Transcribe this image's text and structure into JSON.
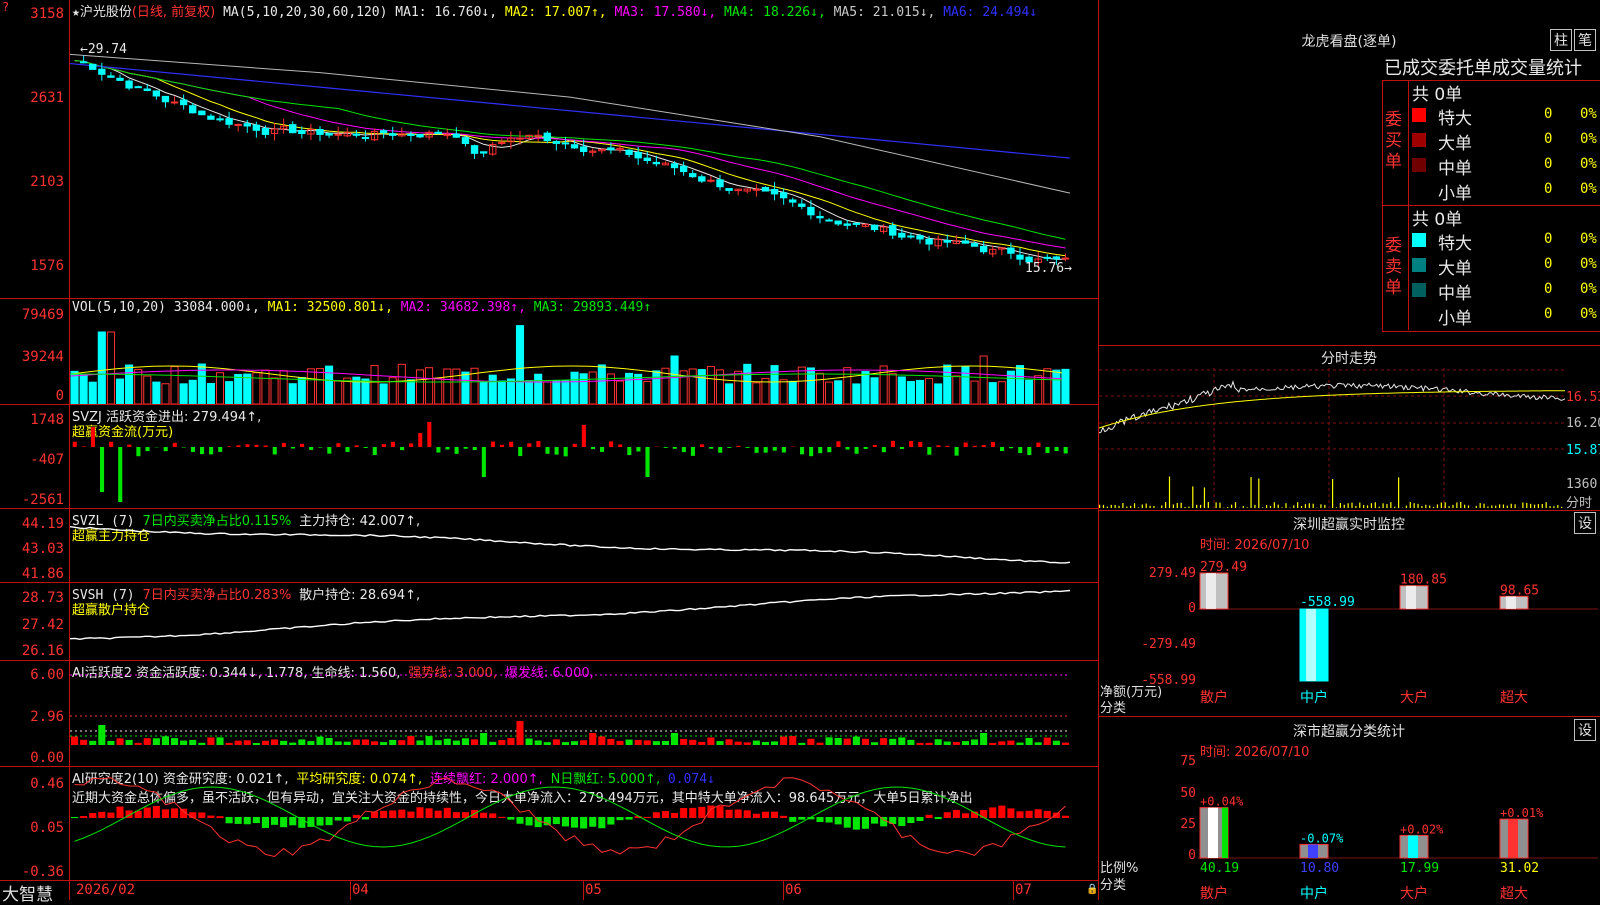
{
  "stock": {
    "marker": "★",
    "name": "沪光股份",
    "mode": "(日线, 前复权)",
    "ma_head": "MA(5,10,20,30,60,120)",
    "ma1": "MA1: 16.760↓,",
    "ma2": "MA2: 17.007↑,",
    "ma3": "MA3: 17.580↓,",
    "ma4": "MA4: 18.226↓,",
    "ma5": "MA5: 21.015↓,",
    "ma6": "MA6: 24.494↓"
  },
  "price_axis": [
    "3158",
    "2631",
    "2103",
    "1576"
  ],
  "price_annot": {
    "high": "←29.74",
    "low": "15.76→"
  },
  "vol": {
    "head": "VOL(5,10,20)",
    "value": "33084.000↓,",
    "ma1": "MA1: 32500.801↓,",
    "ma2": "MA2: 34682.398↑,",
    "ma3": "MA3: 29893.449↑",
    "axis": [
      "79469",
      "39244",
      "0"
    ]
  },
  "svzj": {
    "head": "SVZJ  活跃资金进出: 279.494↑,",
    "sub": "超赢资金流(万元)",
    "axis": [
      "1748",
      "-407",
      "-2561"
    ]
  },
  "svzl": {
    "head": "SVZL (7)",
    "ratio": "7日内买卖净占比0.115%",
    "hold": "主力持仓: 42.007↑,",
    "sub": "超赢主力持仓",
    "axis": [
      "44.19",
      "43.03",
      "41.86"
    ]
  },
  "svsh": {
    "head": "SVSH (7)",
    "ratio": "7日内买卖净占比0.283%",
    "hold": "散户持仓: 28.694↑,",
    "sub": "超赢散户持仓",
    "axis": [
      "28.73",
      "27.42",
      "26.16"
    ]
  },
  "ai1": {
    "head": "AI活跃度2 资金活跃度: 0.344↓, 1.778, 生命线: 1.560,",
    "strong": "强势线: 3.000,",
    "burst": "爆发线: 6.000,",
    "axis": [
      "6.00",
      "2.96",
      "0.00"
    ]
  },
  "ai2": {
    "head": "AI研究度2(10) 资金研究度: 0.021↑,",
    "avg": "平均研究度: 0.074↑,",
    "streak": "连续飘红: 2.000↑,",
    "nday": "N日飘红: 5.000↑,",
    "last": "0.074↓",
    "note": "近期大资金总体偏多，虽不活跃，但有异动，宜关注大资金的持续性，今日大单净流入：279.494万元，其中特大单净流入：98.645万元，大单5日累计净出",
    "axis": [
      "0.46",
      "0.05",
      "-0.36"
    ]
  },
  "timeline": {
    "brand": "大智慧",
    "labels": [
      "2026/02",
      "04",
      "05",
      "06",
      "07"
    ]
  },
  "dragon": {
    "title": "龙虎看盘(逐单)",
    "btn1": "柱",
    "btn2": "笔",
    "subtitle": "已成交委托单成交量统计",
    "buy": {
      "label": "委买单",
      "total": "共 0单",
      "rows": [
        {
          "name": "特大",
          "n": "0",
          "p": "0%",
          "color": "#ff0000"
        },
        {
          "name": "大单",
          "n": "0",
          "p": "0%",
          "color": "#a00000"
        },
        {
          "name": "中单",
          "n": "0",
          "p": "0%",
          "color": "#700000"
        },
        {
          "name": "小单",
          "n": "0",
          "p": "0%",
          "color": "#000000"
        }
      ]
    },
    "sell": {
      "label": "委卖单",
      "total": "共 0单",
      "rows": [
        {
          "name": "特大",
          "n": "0",
          "p": "0%",
          "color": "#00ffff"
        },
        {
          "name": "大单",
          "n": "0",
          "p": "0%",
          "color": "#008080"
        },
        {
          "name": "中单",
          "n": "0",
          "p": "0%",
          "color": "#006060"
        },
        {
          "name": "小单",
          "n": "0",
          "p": "0%",
          "color": "#000000"
        }
      ]
    }
  },
  "intraday": {
    "title": "分时走势",
    "axis": [
      "16.53",
      "16.20",
      "15.87"
    ],
    "vol_axis": [
      "1360",
      "分时"
    ]
  },
  "monitor": {
    "title": "深圳超赢实时监控",
    "btn": "设",
    "time": "时间: 2026/07/10",
    "axis": [
      "279.49",
      "0",
      "-279.49",
      "-558.99"
    ],
    "footer": [
      "净额(万元)",
      "分类"
    ],
    "bars": [
      {
        "name": "散户",
        "value": 279.49,
        "label": "279.49"
      },
      {
        "name": "中户",
        "value": -558.99,
        "label": "-558.99"
      },
      {
        "name": "大户",
        "value": 180.85,
        "label": "180.85"
      },
      {
        "name": "超大",
        "value": 98.65,
        "label": "98.65"
      }
    ]
  },
  "classify": {
    "title": "深市超赢分类统计",
    "btn": "设",
    "time": "时间: 2026/07/10",
    "axis": [
      "75",
      "50",
      "25",
      "0"
    ],
    "footer": [
      "比例%",
      "分类"
    ],
    "bars": [
      {
        "name": "散户",
        "value": 40.19,
        "label": "40.19",
        "chg": "+0.04%"
      },
      {
        "name": "中户",
        "value": 10.8,
        "label": "10.80",
        "chg": "-0.07%"
      },
      {
        "name": "大户",
        "value": 17.99,
        "label": "17.99",
        "chg": "+0.02%"
      },
      {
        "name": "超大",
        "value": 31.02,
        "label": "31.02",
        "chg": "+0.01%"
      }
    ]
  }
}
